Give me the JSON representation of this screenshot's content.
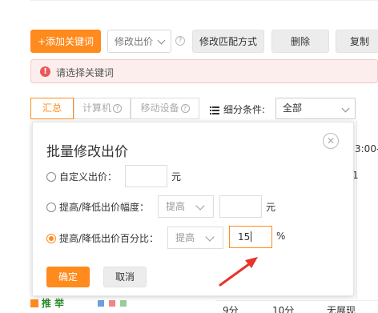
{
  "toolbar": {
    "add_keyword": "+添加关键词",
    "modify_bid": "修改出价",
    "modify_match": "修改匹配方式",
    "delete": "删除",
    "copy": "复制"
  },
  "alert": {
    "message": "请选择关键词"
  },
  "tabs": [
    {
      "label": "汇总",
      "active": true
    },
    {
      "label": "计算机",
      "active": false
    },
    {
      "label": "移动设备",
      "active": false
    }
  ],
  "filter": {
    "label": "细分条件:",
    "value": "全部"
  },
  "background": {
    "time_header": "3:00-",
    "col_text": "1",
    "bottom_cells": [
      "9分",
      "10分",
      "无展现"
    ],
    "left_peek": "推 举"
  },
  "modal": {
    "title": "批量修改出价",
    "rows": [
      {
        "label": "自定义出价：",
        "value": "",
        "unit": "元",
        "checked": false
      },
      {
        "label": "提高/降低出价幅度：",
        "select": "提高",
        "value": "",
        "unit": "元",
        "checked": false
      },
      {
        "label": "提高/降低出价百分比：",
        "select": "提高",
        "value": "15",
        "unit": "%",
        "checked": true
      }
    ],
    "confirm": "确定",
    "cancel": "取消"
  },
  "colors": {
    "accent": "#ff8a1e",
    "alert_bg": "#fdeeee",
    "alert_icon": "#e85a5a",
    "arrow": "#e8322b"
  },
  "icons": {
    "help": "question-circle-icon",
    "close": "close-circle-icon",
    "alert": "exclamation-circle-icon",
    "filter": "list-icon",
    "dropdown": "chevron-down-icon"
  }
}
